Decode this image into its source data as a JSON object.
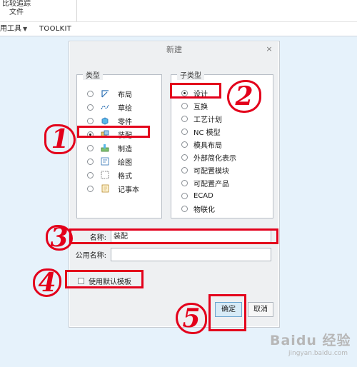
{
  "ribbon": {
    "top_labels": [
      "比较追踪",
      "文件"
    ],
    "tools_menu": "用工具",
    "toolkit_tab": "TOOLKIT"
  },
  "dialog": {
    "title": "新建",
    "close": "×",
    "type_group": {
      "title": "类型",
      "items": [
        {
          "label": "布局",
          "icon": "layout-icon",
          "selected": false
        },
        {
          "label": "草绘",
          "icon": "sketch-icon",
          "selected": false
        },
        {
          "label": "零件",
          "icon": "part-icon",
          "selected": false
        },
        {
          "label": "装配",
          "icon": "assembly-icon",
          "selected": true
        },
        {
          "label": "制造",
          "icon": "manufacturing-icon",
          "selected": false
        },
        {
          "label": "绘图",
          "icon": "drawing-icon",
          "selected": false
        },
        {
          "label": "格式",
          "icon": "format-icon",
          "selected": false
        },
        {
          "label": "记事本",
          "icon": "notebook-icon",
          "selected": false
        }
      ]
    },
    "subtype_group": {
      "title": "子类型",
      "items": [
        {
          "label": "设计",
          "selected": true
        },
        {
          "label": "互换",
          "selected": false
        },
        {
          "label": "工艺计划",
          "selected": false
        },
        {
          "label": "NC 模型",
          "selected": false
        },
        {
          "label": "模具布局",
          "selected": false
        },
        {
          "label": "外部简化表示",
          "selected": false
        },
        {
          "label": "可配置模块",
          "selected": false
        },
        {
          "label": "可配置产品",
          "selected": false
        },
        {
          "label": "ECAD",
          "selected": false
        },
        {
          "label": "物联化",
          "selected": false
        }
      ]
    },
    "name_label": "名称:",
    "name_value": "装配",
    "common_name_label": "公用名称:",
    "common_name_value": "",
    "use_default_template_label": "使用默认模板",
    "use_default_template_checked": false,
    "ok_label": "确定",
    "cancel_label": "取消"
  },
  "annotations": {
    "callout_1": "1",
    "callout_2": "2",
    "callout_3": "3",
    "callout_4": "4",
    "callout_5": "5",
    "color": "#e3001b"
  },
  "watermark": {
    "brand": "Baidu 经验",
    "url": "jingyan.baidu.com"
  }
}
